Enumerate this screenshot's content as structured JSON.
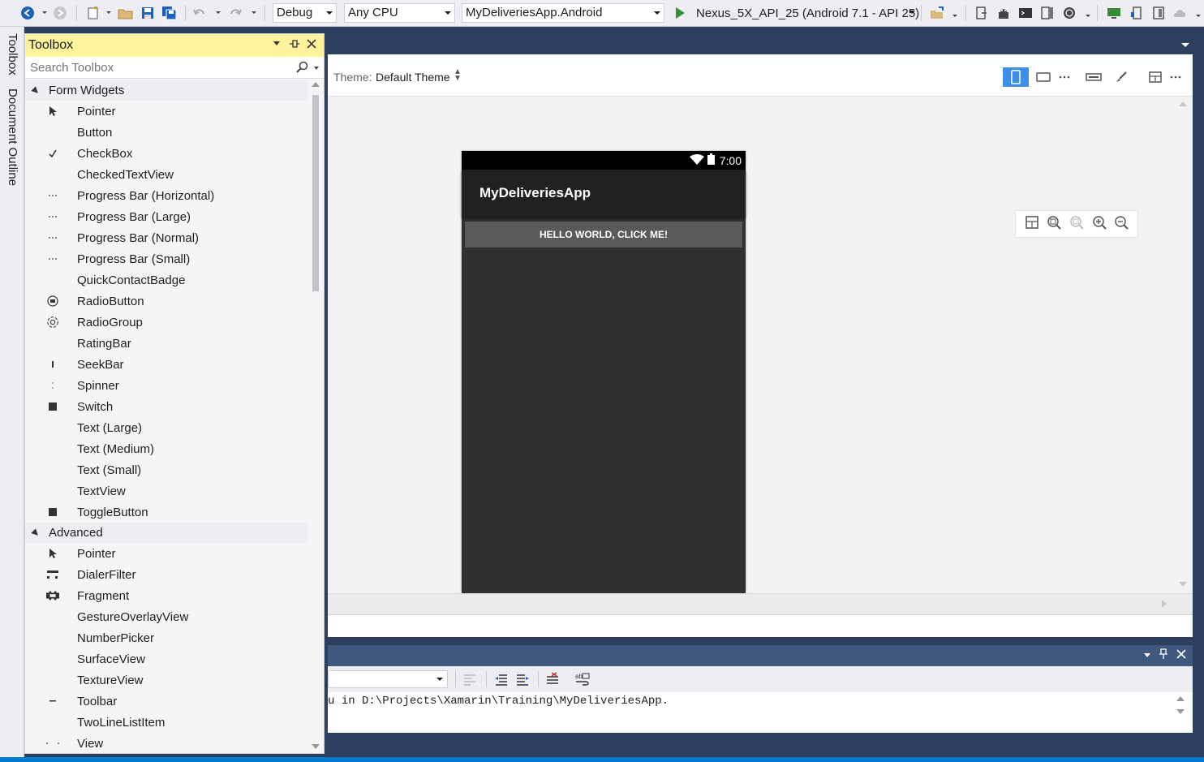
{
  "toolbar": {
    "configuration": "Debug",
    "platform": "Any CPU",
    "startup_project": "MyDeliveriesApp.Android",
    "run_target": "Nexus_5X_API_25 (Android 7.1 - API 25)"
  },
  "side_tabs": [
    "Toolbox",
    "Document Outline"
  ],
  "toolbox": {
    "title": "Toolbox",
    "search_placeholder": "Search Toolbox",
    "groups": [
      {
        "name": "Form Widgets",
        "items": [
          {
            "label": "Pointer",
            "icon": "pointer-icon"
          },
          {
            "label": "Button",
            "icon": ""
          },
          {
            "label": "CheckBox",
            "icon": "checkmark-icon"
          },
          {
            "label": "CheckedTextView",
            "icon": ""
          },
          {
            "label": "Progress Bar (Horizontal)",
            "icon": "progress-dots-icon"
          },
          {
            "label": "Progress Bar (Large)",
            "icon": "progress-dots-icon"
          },
          {
            "label": "Progress Bar (Normal)",
            "icon": "progress-dots-icon"
          },
          {
            "label": "Progress Bar (Small)",
            "icon": "progress-dots-icon"
          },
          {
            "label": "QuickContactBadge",
            "icon": ""
          },
          {
            "label": "RadioButton",
            "icon": "radio-button-icon"
          },
          {
            "label": "RadioGroup",
            "icon": "radio-group-icon"
          },
          {
            "label": "RatingBar",
            "icon": ""
          },
          {
            "label": "SeekBar",
            "icon": "seekbar-icon"
          },
          {
            "label": "Spinner",
            "icon": "spinner-icon"
          },
          {
            "label": "Switch",
            "icon": "switch-icon"
          },
          {
            "label": "Text (Large)",
            "icon": ""
          },
          {
            "label": "Text (Medium)",
            "icon": ""
          },
          {
            "label": "Text (Small)",
            "icon": ""
          },
          {
            "label": "TextView",
            "icon": ""
          },
          {
            "label": "ToggleButton",
            "icon": "toggle-icon"
          }
        ]
      },
      {
        "name": "Advanced",
        "items": [
          {
            "label": "Pointer",
            "icon": "pointer-icon"
          },
          {
            "label": "DialerFilter",
            "icon": "dialer-filter-icon"
          },
          {
            "label": "Fragment",
            "icon": "fragment-icon"
          },
          {
            "label": "GestureOverlayView",
            "icon": ""
          },
          {
            "label": "NumberPicker",
            "icon": ""
          },
          {
            "label": "SurfaceView",
            "icon": ""
          },
          {
            "label": "TextureView",
            "icon": ""
          },
          {
            "label": "Toolbar",
            "icon": "toolbar-dash-icon"
          },
          {
            "label": "TwoLineListItem",
            "icon": ""
          },
          {
            "label": "View",
            "icon": "view-dots-icon"
          }
        ]
      }
    ]
  },
  "designer": {
    "theme_label": "Theme:",
    "theme_value": "Default Theme",
    "phone": {
      "time": "7:00",
      "app_title": "MyDeliveriesApp",
      "button_text": "HELLO WORLD, CLICK ME!"
    }
  },
  "output": {
    "text": "u in D:\\Projects\\Xamarin\\Training\\MyDeliveriesApp."
  },
  "colors": {
    "toolbox_title_bg": "#fff29d",
    "ide_frame": "#2d3f5e",
    "status_bar": "#007acc",
    "run_green": "#388a34"
  }
}
